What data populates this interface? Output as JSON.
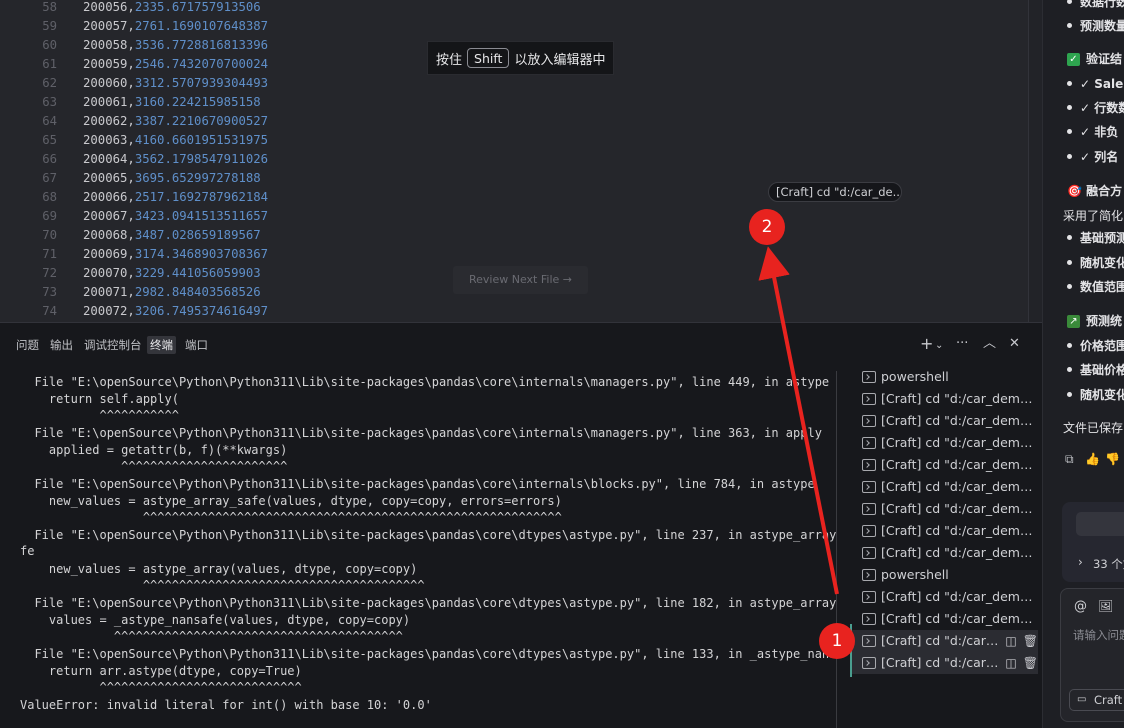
{
  "editor": {
    "lines": [
      {
        "n": "58",
        "id": "200056",
        "v": "2335.671757913506"
      },
      {
        "n": "59",
        "id": "200057",
        "v": "2761.1690107648387"
      },
      {
        "n": "60",
        "id": "200058",
        "v": "3536.7728816813396"
      },
      {
        "n": "61",
        "id": "200059",
        "v": "2546.7432070700024"
      },
      {
        "n": "62",
        "id": "200060",
        "v": "3312.5707939304493"
      },
      {
        "n": "63",
        "id": "200061",
        "v": "3160.224215985158"
      },
      {
        "n": "64",
        "id": "200062",
        "v": "3387.2210670900527"
      },
      {
        "n": "65",
        "id": "200063",
        "v": "4160.6601951531975"
      },
      {
        "n": "66",
        "id": "200064",
        "v": "3562.1798547911026"
      },
      {
        "n": "67",
        "id": "200065",
        "v": "3695.652997278188"
      },
      {
        "n": "68",
        "id": "200066",
        "v": "2517.1692787962184"
      },
      {
        "n": "69",
        "id": "200067",
        "v": "3423.0941513511657"
      },
      {
        "n": "70",
        "id": "200068",
        "v": "3487.028659189567"
      },
      {
        "n": "71",
        "id": "200069",
        "v": "3174.3468903708367"
      },
      {
        "n": "72",
        "id": "200070",
        "v": "3229.441056059903"
      },
      {
        "n": "73",
        "id": "200071",
        "v": "2982.848403568526"
      },
      {
        "n": "74",
        "id": "200072",
        "v": "3206.7495374616497"
      }
    ],
    "hint_before": "按住",
    "hint_key": "Shift",
    "hint_after": "以放入编辑器中",
    "craft_tooltip": "[Craft] cd \"d:/car_de...",
    "review_button": "Review Next File →"
  },
  "panel": {
    "tabs": [
      "问题",
      "输出",
      "调试控制台",
      "终端",
      "端口"
    ],
    "active_tab": "终端",
    "icons": {
      "add": "+",
      "dropdown": "⌄",
      "more": "···",
      "maximize": "︿",
      "close": "✕"
    },
    "terminal_lines": [
      "             ^^^^^^^^^^^^^^^^^^^^^^^^^^^^^^^^^^^^^^^^^^^^^^^^^^^^^^^^^^",
      "  File \"E:\\openSource\\Python\\Python311\\Lib\\site-packages\\pandas\\core\\internals\\managers.py\", line 449, in astype",
      "    return self.apply(",
      "           ^^^^^^^^^^^",
      "  File \"E:\\openSource\\Python\\Python311\\Lib\\site-packages\\pandas\\core\\internals\\managers.py\", line 363, in apply",
      "    applied = getattr(b, f)(**kwargs)",
      "              ^^^^^^^^^^^^^^^^^^^^^^^",
      "  File \"E:\\openSource\\Python\\Python311\\Lib\\site-packages\\pandas\\core\\internals\\blocks.py\", line 784, in astype",
      "    new_values = astype_array_safe(values, dtype, copy=copy, errors=errors)",
      "                 ^^^^^^^^^^^^^^^^^^^^^^^^^^^^^^^^^^^^^^^^^^^^^^^^^^^^^^^^^^",
      "  File \"E:\\openSource\\Python\\Python311\\Lib\\site-packages\\pandas\\core\\dtypes\\astype.py\", line 237, in astype_array_sa",
      "fe",
      "    new_values = astype_array(values, dtype, copy=copy)",
      "                 ^^^^^^^^^^^^^^^^^^^^^^^^^^^^^^^^^^^^^^^",
      "  File \"E:\\openSource\\Python\\Python311\\Lib\\site-packages\\pandas\\core\\dtypes\\astype.py\", line 182, in astype_array",
      "    values = _astype_nansafe(values, dtype, copy=copy)",
      "             ^^^^^^^^^^^^^^^^^^^^^^^^^^^^^^^^^^^^^^^^",
      "  File \"E:\\openSource\\Python\\Python311\\Lib\\site-packages\\pandas\\core\\dtypes\\astype.py\", line 133, in _astype_nansafe",
      "    return arr.astype(dtype, copy=True)",
      "           ^^^^^^^^^^^^^^^^^^^^^^^^^^^^",
      "ValueError: invalid literal for int() with base 10: '0.0'"
    ],
    "sessions": [
      "powershell",
      "[Craft] cd \"d:/car_demo/...",
      "[Craft] cd \"d:/car_demo/...",
      "[Craft] cd \"d:/car_demo/...",
      "[Craft] cd \"d:/car_demo/...",
      "[Craft] cd \"d:/car_demo/...",
      "[Craft] cd \"d:/car_demo/...",
      "[Craft] cd \"d:/car_demo/...",
      "[Craft] cd \"d:/car_demo/...",
      "powershell",
      "[Craft] cd \"d:/car_demo/...",
      "[Craft] cd \"d:/car_demo/...",
      "[Craft] cd \"d:/car_...",
      "[Craft] cd \"d:/car_..."
    ],
    "session_actions": {
      "split": "◫",
      "delete": "🗑"
    }
  },
  "chat": {
    "lines": [
      {
        "type": "bullet",
        "text": "数据行数"
      },
      {
        "type": "bullet",
        "text": "预测数量"
      },
      {
        "type": "check",
        "text": "验证结"
      },
      {
        "type": "bullet",
        "text": "✓ Sale"
      },
      {
        "type": "bullet",
        "text": "✓ 行数数"
      },
      {
        "type": "bullet",
        "text": "✓ 非负"
      },
      {
        "type": "bullet",
        "text": "✓ 列名"
      },
      {
        "type": "target",
        "text": "🎯 融合方"
      },
      {
        "type": "plain",
        "text": "采用了简化"
      },
      {
        "type": "bullet",
        "text": "基础预测"
      },
      {
        "type": "bullet",
        "text": "随机变化"
      },
      {
        "type": "bullet",
        "text": "数值范围"
      },
      {
        "type": "stat",
        "text": "预测统"
      },
      {
        "type": "bullet",
        "text": "价格范围"
      },
      {
        "type": "bullet",
        "text": "基础价格"
      },
      {
        "type": "bullet",
        "text": "随机变化"
      },
      {
        "type": "plain",
        "text": "文件已保存"
      }
    ],
    "icons": [
      "⧉",
      "👍",
      "👎",
      "↻"
    ],
    "collapsed_summary": "33 个文",
    "input_icons": [
      "@",
      "🖼"
    ],
    "input_placeholder": "请输入问题",
    "footer_button": "Craft"
  },
  "annotations": {
    "marker1": "1",
    "marker2": "2",
    "arrow_color": "#e8231f"
  }
}
